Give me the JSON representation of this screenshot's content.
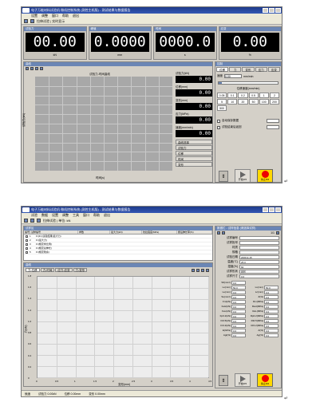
{
  "window1": {
    "title": "电子万能材料试验机 微机控制系统 (测控主机版) - 测试结果与数据报告",
    "menu": [
      "设置",
      "调整",
      "窗口",
      "帮助",
      "退出"
    ],
    "toolbar_text": "拉伸试验  |  实时显示",
    "meters": [
      {
        "head": "试验力",
        "value": "00.00",
        "unit": "kN",
        "sub": "kN"
      },
      {
        "head": "峰值",
        "value": "0.0000",
        "unit": "mm",
        "sub": "mm"
      },
      {
        "head": "时间",
        "value": "0000.0",
        "unit": "s",
        "sub": "s"
      },
      {
        "head": "应变",
        "value": "0.00",
        "unit": "%",
        "sub": "%"
      }
    ],
    "chart_head": "曲线",
    "chart_title": "试验力-时间曲线",
    "chart_xlabel": "时间(s)",
    "chart_ylabel": "试验力(kN)",
    "side_values": [
      {
        "label": "试验力(kN)",
        "value": "0.00"
      },
      {
        "label": "位移(mm)",
        "value": "0.00"
      },
      {
        "label": "变形(mm)",
        "value": "0.00"
      },
      {
        "label": "应力(MPa)",
        "value": "0.00"
      },
      {
        "label": "速度(mm/min)",
        "value": "0.00"
      }
    ],
    "side_buttons": [
      "曲线选择",
      "试验力",
      "位移",
      "时间",
      "变形"
    ],
    "ctrl_head": "控制",
    "ctrl_tabs": [
      "位移",
      "力",
      "变形",
      "应力",
      "应变"
    ],
    "speed_label": "速度",
    "speed_value": "0.00",
    "speed_unit": "mm/min",
    "speed_table_head": "位移速度(mm/min)",
    "speed_presets": [
      "0.05",
      "0.1",
      "0.2",
      "0.5",
      "1",
      "2",
      "5",
      "10",
      "20",
      "50",
      "100",
      "200",
      "500"
    ],
    "check1": "自动保存数据",
    "check2": "试验结束后返回",
    "run_label": "开始/F5",
    "stop_label": "停止/F6"
  },
  "window2": {
    "title": "电子万能材料试验机 微机控制系统 (测控主机版) - 测试结果与数据报告",
    "menu": [
      "试验",
      "数据",
      "设置",
      "调整",
      "工具",
      "窗口",
      "帮助",
      "退出"
    ],
    "toolbar_text": "拉伸试验  |  单位: kN",
    "sample_head": "试样区",
    "sample_cols": [
      "编号",
      "试样编号",
      "参数",
      "最大力(kN)",
      "抗拉强度(MPa)",
      "断后伸长率(%)"
    ],
    "sample_rows": [
      {
        "no": "1",
        "name": "Fr(Fr)(试验结果(最大力)",
        "val": ""
      },
      {
        "no": "2",
        "name": "Fr(最大力)",
        "val": ""
      },
      {
        "no": "3",
        "name": "Fr(规定非比例)",
        "val": ""
      },
      {
        "no": "4",
        "name": "Fr(规定总伸长)",
        "val": ""
      },
      {
        "no": "5",
        "name": "Fr(规定残余)",
        "val": ""
      }
    ],
    "chart_head": "曲线",
    "chart_tabs": [
      "力-位移",
      "力-时间",
      "应力-应变",
      "力-变形"
    ],
    "chart_ylabel": "力(kN)",
    "chart_xlabel": "变形(mm)",
    "y_ticks": [
      "1.8",
      "1.6",
      "1.4",
      "1.2",
      "1.0",
      "0.8",
      "0.6",
      "0.4",
      "0.2",
      "0"
    ],
    "x_ticks": [
      "0",
      "0.5",
      "1",
      "1.5",
      "2",
      "2.5",
      "3",
      "3.5",
      "4",
      "4.5"
    ],
    "status": [
      "就绪",
      "试验力 0.00kN",
      "位移 0.00mm",
      "变形 0.00mm"
    ],
    "right_head": "数据栏 - 试样信息 (请选择试样)",
    "right_page": "1/1",
    "right_fields": [
      {
        "label": "试样编号",
        "value": ""
      },
      {
        "label": "试样批号",
        "value": ""
      },
      {
        "label": "材质",
        "value": ""
      },
      {
        "label": "规格",
        "value": ""
      },
      {
        "label": "试验日期",
        "value": "2009-9-15"
      },
      {
        "label": "温度(℃)",
        "value": "25.0"
      },
      {
        "label": "湿度(%)",
        "value": "60"
      },
      {
        "label": "试样形状",
        "value": "圆形"
      },
      {
        "label": "试样尺寸",
        "value": "0.0"
      }
    ],
    "param_rows": [
      {
        "a": "S0(mm²)",
        "av": "0.0",
        "b": "",
        "bv": ""
      },
      {
        "a": "Lo(mm)",
        "av": "50.0",
        "b": "Lu(mm)",
        "bv": "50.0"
      },
      {
        "a": "Le(mm)",
        "av": "0.0",
        "b": "Lc(mm)",
        "bv": "0.0"
      },
      {
        "a": "Su(mm²)",
        "av": "0.0",
        "b": "Z(%)",
        "bv": "0.0"
      },
      {
        "a": "Fm(kN)",
        "av": "0.0",
        "b": "Rm(MPa)",
        "bv": "0.0"
      },
      {
        "a": "FeH(kN)",
        "av": "0.0",
        "b": "ReH(MPa)",
        "bv": "0.0"
      },
      {
        "a": "FeL(kN)",
        "av": "0.0",
        "b": "ReL(MPa)",
        "bv": "0.0"
      },
      {
        "a": "Fp0.2(kN)",
        "av": "0.0",
        "b": "Rp0.2(MPa)",
        "bv": "0.0"
      },
      {
        "a": "Ft0.5(kN)",
        "av": "0.0",
        "b": "Rt0.5(MPa)",
        "bv": "0.0"
      },
      {
        "a": "Fr0.2(kN)",
        "av": "0.0",
        "b": "Rr0.2(MPa)",
        "bv": "0.0"
      },
      {
        "a": "E(GPa)",
        "av": "0.0",
        "b": "A(%)",
        "bv": "0.0"
      },
      {
        "a": "Agt(%)",
        "av": "0.0",
        "b": "Ag(%)",
        "bv": "0.0"
      }
    ],
    "run_label": "开始/F5",
    "stop_label": "停止/F6"
  },
  "colors": {
    "panel": "#d4d0c8",
    "title": "#1e3a8a",
    "head": "#6b86b5",
    "lcd": "#000000",
    "plot1": "#a8a8a8",
    "plot2": "#ededed",
    "stop": "#ee0000",
    "stop_bg": "#ffd800"
  }
}
